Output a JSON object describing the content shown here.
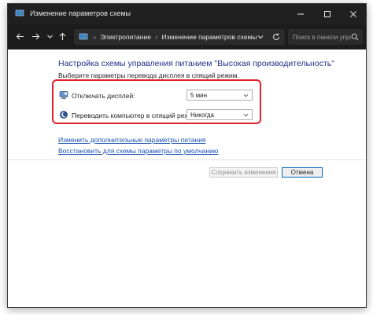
{
  "window": {
    "title": "Изменение параметров схемы",
    "minimize_label": "",
    "maximize_label": "",
    "close_label": ""
  },
  "navigation": {
    "breadcrumb": [
      "Электропитание",
      "Изменение параметров схемы"
    ],
    "breadcrumb_separator": "›",
    "search_placeholder": "Поиск в панели упра..."
  },
  "content": {
    "heading": "Настройка схемы управления питанием \"Высокая производительность\"",
    "subheading": "Выберите параметры перевода дисплея в спящий режим.",
    "settings": [
      {
        "label": "Отключать дисплей:",
        "value": "5 мин",
        "icon": "display-icon"
      },
      {
        "label": "Переводить компьютер в спящий режим:",
        "value": "Никогда",
        "icon": "sleep-icon"
      }
    ],
    "links": {
      "advanced": "Изменить дополнительные параметры питания",
      "restore": "Восстановить для схемы параметры по умолчанию"
    },
    "buttons": {
      "save": "Сохранить изменения",
      "cancel": "Отмена"
    }
  },
  "colors": {
    "titlebar_bg": "#202020",
    "navbar_bg": "#1c1c1c",
    "heading": "#1e3287",
    "link": "#1a4fb5",
    "highlight_border": "#e0202a",
    "primary_button_border": "#0067c0"
  }
}
